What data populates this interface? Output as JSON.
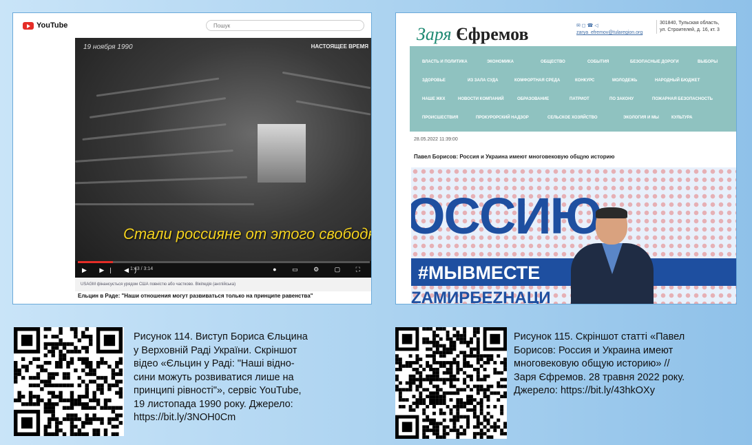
{
  "left_figure": {
    "yt_logo_text": "YouTube",
    "search_placeholder": "Пошук",
    "video_date": "19 ноября 1990",
    "channel_mark": "НАСТОЯЩЕЕ ВРЕМЯ",
    "subtitle": "Стали россияне от этого свободными?",
    "time": "1:43 / 3:14",
    "info_text": "USAGM фінансується урядом США повністю або частково. Вікіпедія (англійська)",
    "video_title": "Ельцин в Раде: \"Наши отношения могут развиваться только на принципе равенства\"",
    "caption_lines": [
      "Рисунок 114. Виступ Бориса Єльцина",
      "у Верховній Раді України. Скріншот",
      "відео «Єльцин у Раді: \"Наші відно-",
      "сини можуть розвиватися лише на",
      "принципі рівності\"», сервіс YouTube,",
      "19 листопада 1990 року. Джерело:",
      "https://bit.ly/3NOH0Cm"
    ]
  },
  "right_figure": {
    "site_logo_1": "Заря",
    "site_logo_2": "Єфремов",
    "email": "zarya_efremov@tularegion.org",
    "address_1": "301840, Тульская область,",
    "address_2": "ул. Строителей, д. 16, кт. 3",
    "nav_rows": [
      [
        "ВЛАСТЬ И ПОЛИТИКА",
        "ЭКОНОМИКА",
        "ОБЩЕСТВО",
        "СОБЫТИЯ",
        "БЕЗОПАСНЫЕ ДОРОГИ",
        "ВЫБОРЫ"
      ],
      [
        "ЗДОРОВЬЕ",
        "ИЗ ЗАЛА СУДА",
        "КОМФОРТНАЯ СРЕДА",
        "КОНКУРС",
        "МОЛОДЕЖЬ",
        "НАРОДНЫЙ БЮДЖЕТ"
      ],
      [
        "НАШЕ ЖКХ",
        "НОВОСТИ КОМПАНИЙ",
        "ОБРАЗОВАНИЕ",
        "ПАТРИОТ",
        "ПО ЗАКОНУ",
        "ПОЖАРНАЯ БЕЗОПАСНОСТЬ"
      ],
      [
        "ПРОИСШЕСТВИЯ",
        "ПРОКУРОРСКИЙ НАДЗОР",
        "СЕЛЬСКОЕ ХОЗЯЙСТВО",
        "ЭКОЛОГИЯ И МЫ",
        "КУЛЬТУРА"
      ]
    ],
    "date": "28.05.2022 11:39:00",
    "headline": "Павел Борисов: Россия и Украина имеют многовековую общую историю",
    "photo_big": "ОССИЮ",
    "photo_band": "#МЫВМЕСТЕ",
    "photo_band2": "ZАМИРБЕZНАЦИ",
    "caption_lines": [
      "Рисунок 115. Скріншот статті «Павел",
      "Борисов: Россия и Украина имеют",
      "многовековую общую историю» //",
      "Заря Єфремов. 28 травня 2022 року.",
      "Джерело: https://bit.ly/43hkOXy"
    ]
  }
}
